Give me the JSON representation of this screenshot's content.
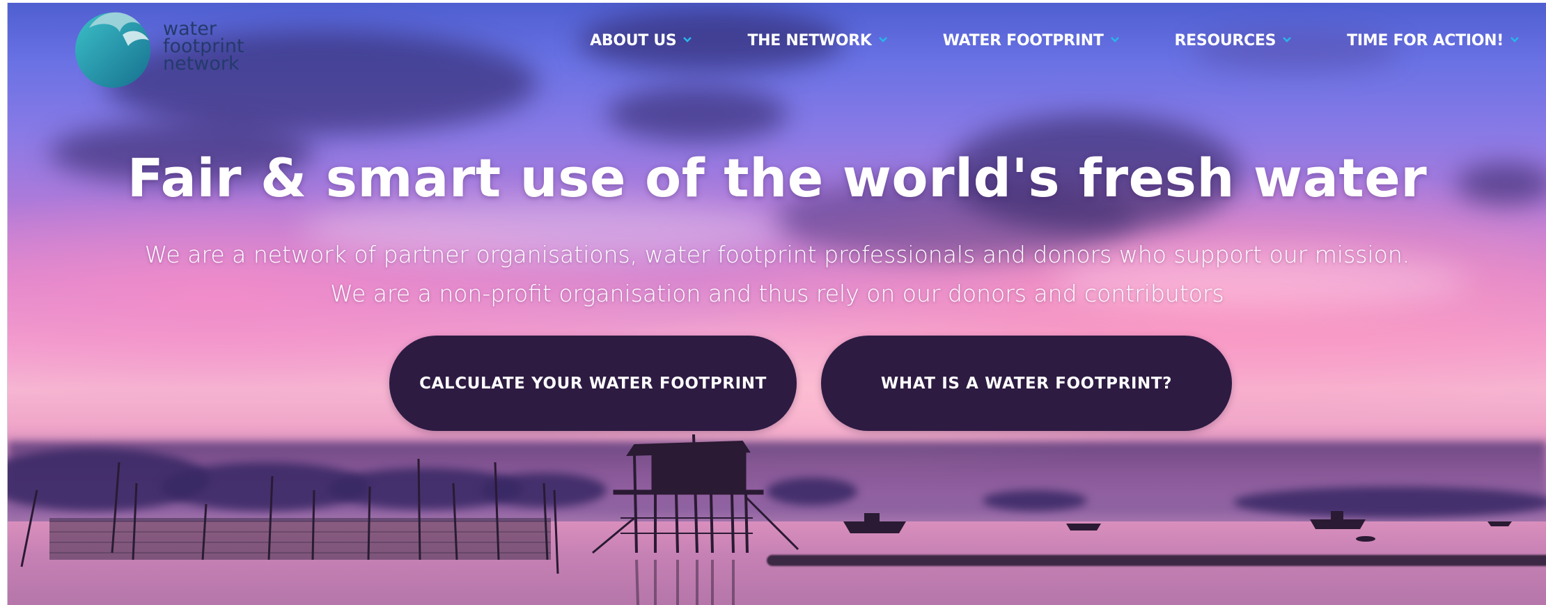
{
  "brand": {
    "name_lines": [
      "water",
      "footprint",
      "network"
    ],
    "text_color": "#243a6b",
    "mark_colors": [
      "#2aa6b8",
      "#1f7f9e",
      "#a7d6dd"
    ]
  },
  "nav": {
    "items": [
      {
        "label": "ABOUT US",
        "icon": "chevron-down-icon"
      },
      {
        "label": "THE NETWORK",
        "icon": "chevron-down-icon"
      },
      {
        "label": "WATER FOOTPRINT",
        "icon": "chevron-down-icon"
      },
      {
        "label": "RESOURCES",
        "icon": "chevron-down-icon"
      },
      {
        "label": "TIME FOR ACTION!",
        "icon": "chevron-down-icon"
      }
    ],
    "chevron_color": "#28b6e8"
  },
  "hero": {
    "title": "Fair & smart use of the world's fresh water",
    "subtitle_line1": "We are a network of partner organisations, water footprint professionals and donors who support our mission.",
    "subtitle_line2": "We are a non-profit organisation and thus rely on our donors and contributors",
    "cta_primary": "CALCULATE YOUR WATER FOOTPRINT",
    "cta_secondary": "WHAT IS A WATER FOOTPRINT?",
    "cta_color": "#2d1b42"
  },
  "background": {
    "scene": "sunset-over-water-photo"
  }
}
